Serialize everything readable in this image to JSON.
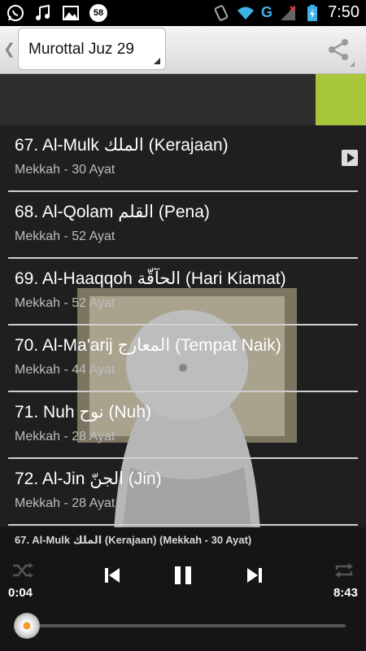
{
  "status_bar": {
    "notification_badge": "58",
    "network_letter": "G",
    "time": "7:50"
  },
  "action_bar": {
    "spinner_value": "Murottal Juz 29"
  },
  "list": [
    {
      "title": "67. Al-Mulk الملك (Kerajaan)",
      "subtitle": "Mekkah - 30 Ayat"
    },
    {
      "title": "68. Al-Qolam القلم (Pena)",
      "subtitle": "Mekkah - 52 Ayat"
    },
    {
      "title": "69. Al-Haaqqoh الحآقّة (Hari Kiamat)",
      "subtitle": "Mekkah - 52 Ayat"
    },
    {
      "title": "70. Al-Ma'arij المعارج (Tempat Naik)",
      "subtitle": "Mekkah - 44 Ayat"
    },
    {
      "title": "71. Nuh نوح (Nuh)",
      "subtitle": "Mekkah - 28 Ayat"
    },
    {
      "title": "72. Al-Jin الجنّ (Jin)",
      "subtitle": "Mekkah - 28 Ayat"
    }
  ],
  "player": {
    "now_playing": "67. Al-Mulk الملك (Kerajaan) (Mekkah - 30 Ayat)",
    "elapsed": "0:04",
    "duration": "8:43",
    "progress_fraction": 0.008
  },
  "colors": {
    "accent_green": "#a8c639",
    "wifi_blue": "#3db1e8",
    "seek_knob_center": "#f39b2c"
  }
}
